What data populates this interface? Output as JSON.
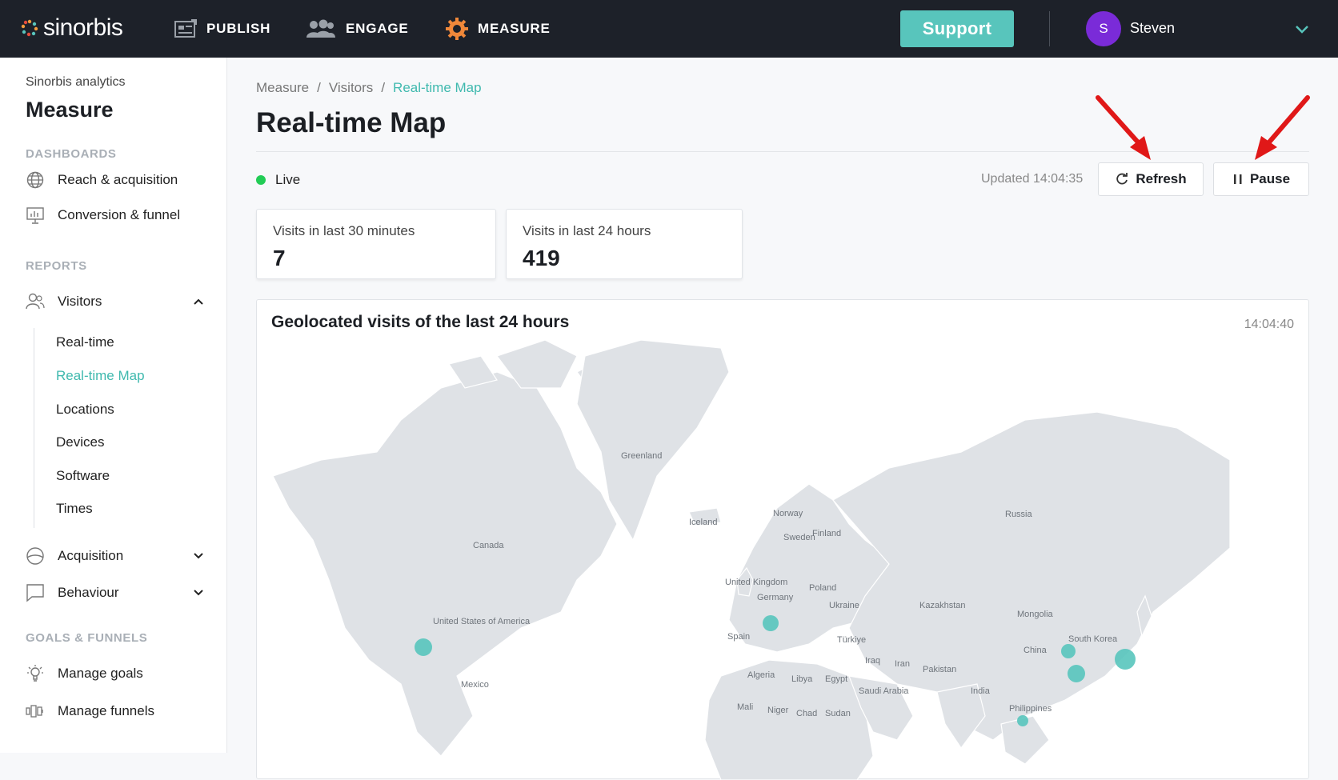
{
  "app": {
    "brand": "sinorbis",
    "accent": "#58c5bc"
  },
  "topnav": {
    "items": [
      {
        "label": "PUBLISH",
        "icon": "publish-icon"
      },
      {
        "label": "ENGAGE",
        "icon": "engage-icon"
      },
      {
        "label": "MEASURE",
        "icon": "measure-gear-icon",
        "active": true
      }
    ],
    "support_label": "Support",
    "user": {
      "initial": "S",
      "name": "Steven"
    }
  },
  "sidebar": {
    "subtitle": "Sinorbis analytics",
    "title": "Measure",
    "dashboards_heading": "DASHBOARDS",
    "dashboards": [
      {
        "label": "Reach & acquisition",
        "icon": "globe-icon"
      },
      {
        "label": "Conversion & funnel",
        "icon": "presentation-chart-icon"
      }
    ],
    "reports_heading": "REPORTS",
    "visitors": {
      "label": "Visitors",
      "icon": "users-icon",
      "expanded": true
    },
    "visitor_children": [
      "Real-time",
      "Real-time Map",
      "Locations",
      "Devices",
      "Software",
      "Times"
    ],
    "active_child": "Real-time Map",
    "acquisition": {
      "label": "Acquisition",
      "icon": "acquisition-icon"
    },
    "behaviour": {
      "label": "Behaviour",
      "icon": "chat-bubble-icon"
    },
    "goals_heading": "GOALS & FUNNELS",
    "manage_goals": {
      "label": "Manage goals",
      "icon": "lightbulb-icon"
    },
    "manage_funnels": {
      "label": "Manage funnels",
      "icon": "funnel-icon"
    }
  },
  "breadcrumb": [
    "Measure",
    "Visitors",
    "Real-time Map"
  ],
  "breadcrumb_sep": "/",
  "page_title": "Real-time Map",
  "status": {
    "live_label": "Live",
    "updated": "Updated 14:04:35"
  },
  "actions": {
    "refresh": "Refresh",
    "pause": "Pause"
  },
  "stats": [
    {
      "label": "Visits in last 30 minutes",
      "value": "7"
    },
    {
      "label": "Visits in last 24 hours",
      "value": "419"
    }
  ],
  "map": {
    "title": "Geolocated visits of the last 24 hours",
    "time": "14:04:40",
    "country_labels": [
      "Greenland",
      "Iceland",
      "Norway",
      "Sweden",
      "Finland",
      "Russia",
      "Canada",
      "United Kingdom",
      "Germany",
      "Poland",
      "Ukraine",
      "Kazakhstan",
      "Mongolia",
      "United States of America",
      "Spain",
      "Türkiye",
      "Iraq",
      "Iran",
      "China",
      "South Korea",
      "Algeria",
      "Libya",
      "Egypt",
      "Saudi Arabia",
      "Pakistan",
      "India",
      "Mexico",
      "Mali",
      "Niger",
      "Chad",
      "Sudan",
      "Philippines"
    ],
    "visit_locations": [
      "United States of America",
      "Europe (Switzerland)",
      "China (North)",
      "China (South)",
      "Japan",
      "Southeast Asia"
    ]
  }
}
